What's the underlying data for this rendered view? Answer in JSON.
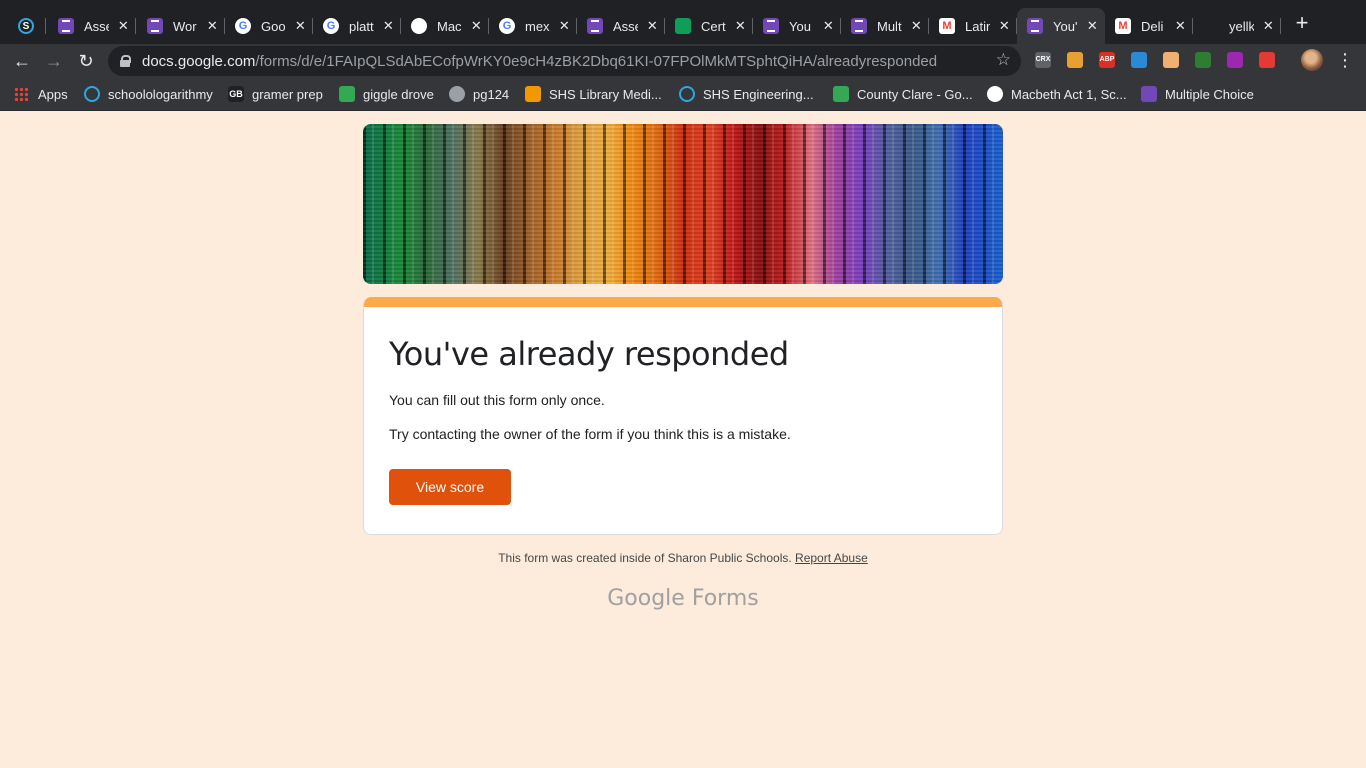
{
  "tabs": [
    {
      "icon": "schoology-icon",
      "title": "",
      "favclass": "schoology"
    },
    {
      "icon": "forms-icon",
      "title": "Asse",
      "favclass": "forms"
    },
    {
      "icon": "forms-icon",
      "title": "Wor",
      "favclass": "forms"
    },
    {
      "icon": "google-icon",
      "title": "Goo",
      "favclass": "google"
    },
    {
      "icon": "google-icon",
      "title": "platt",
      "favclass": "google"
    },
    {
      "icon": "chart-icon",
      "title": "Mac",
      "favclass": "chart"
    },
    {
      "icon": "google-icon",
      "title": "mex",
      "favclass": "google"
    },
    {
      "icon": "forms-icon",
      "title": "Asse",
      "favclass": "forms"
    },
    {
      "icon": "sheets-icon",
      "title": "Cert",
      "favclass": "sheets"
    },
    {
      "icon": "forms-icon",
      "title": "You",
      "favclass": "forms"
    },
    {
      "icon": "forms-icon",
      "title": "Mult",
      "favclass": "forms"
    },
    {
      "icon": "gmail-icon",
      "title": "Latin",
      "favclass": "gmail"
    },
    {
      "icon": "forms-icon",
      "title": "You'",
      "favclass": "forms",
      "active": true
    },
    {
      "icon": "gmail-icon",
      "title": "Deli",
      "favclass": "gmail"
    },
    {
      "icon": "blank-icon",
      "title": "yellk",
      "favclass": "blank"
    }
  ],
  "omnibox": {
    "host": "docs.google.com",
    "path": "/forms/d/e/1FAIpQLSdAbECofpWrKY0e9cH4zBK2Dbq61KI-07FPOlMkMTSphtQiHA/alreadyresponded"
  },
  "extensions": [
    {
      "icon": "crx-icon",
      "label": "CRX",
      "color": "#5f6368"
    },
    {
      "icon": "owl-icon",
      "label": "",
      "color": "#e8a030"
    },
    {
      "icon": "abp-icon",
      "label": "ABP",
      "color": "#d93025"
    },
    {
      "icon": "check-icon",
      "label": "",
      "color": "#2b8ad6"
    },
    {
      "icon": "face-icon",
      "label": "",
      "color": "#f0b070"
    },
    {
      "icon": "leaf-icon",
      "label": "",
      "color": "#2e7d32"
    },
    {
      "icon": "color-icon",
      "label": "",
      "color": "#9c27b0"
    },
    {
      "icon": "brush-icon",
      "label": "",
      "color": "#e53935"
    }
  ],
  "bookmarks": [
    {
      "icon": "apps-grid-icon",
      "label": "Apps",
      "color": "#ea4335"
    },
    {
      "icon": "schoology-icon",
      "label": "schoolologarithmy",
      "color": "#2ea8df"
    },
    {
      "icon": "gb-icon",
      "label": "gramer prep",
      "color": "#202124"
    },
    {
      "icon": "drive-icon",
      "label": "giggle drove",
      "color": "#34a853"
    },
    {
      "icon": "globe-icon",
      "label": "pg124",
      "color": "#9aa0a6"
    },
    {
      "icon": "library-icon",
      "label": "SHS Library Medi...",
      "color": "#f29900"
    },
    {
      "icon": "schoology-icon",
      "label": "SHS Engineering...",
      "color": "#2ea8df"
    },
    {
      "icon": "maps-icon",
      "label": "County Clare - Go...",
      "color": "#34a853"
    },
    {
      "icon": "chart-icon",
      "label": "Macbeth Act 1, Sc...",
      "color": "#ffffff"
    },
    {
      "icon": "forms-icon",
      "label": "Multiple Choice",
      "color": "#7248b9"
    }
  ],
  "form": {
    "title": "You've already responded",
    "line1": "You can fill out this form only once.",
    "line2": "Try contacting the owner of the form if you think this is a mistake.",
    "button": "View score"
  },
  "footer": {
    "text": "This form was created inside of Sharon Public Schools.",
    "link": "Report Abuse",
    "brand_google": "Google",
    "brand_forms": "Forms"
  },
  "colors": {
    "page_bg": "#fdecdc",
    "accent": "#fba94b",
    "button": "#e0510b"
  }
}
